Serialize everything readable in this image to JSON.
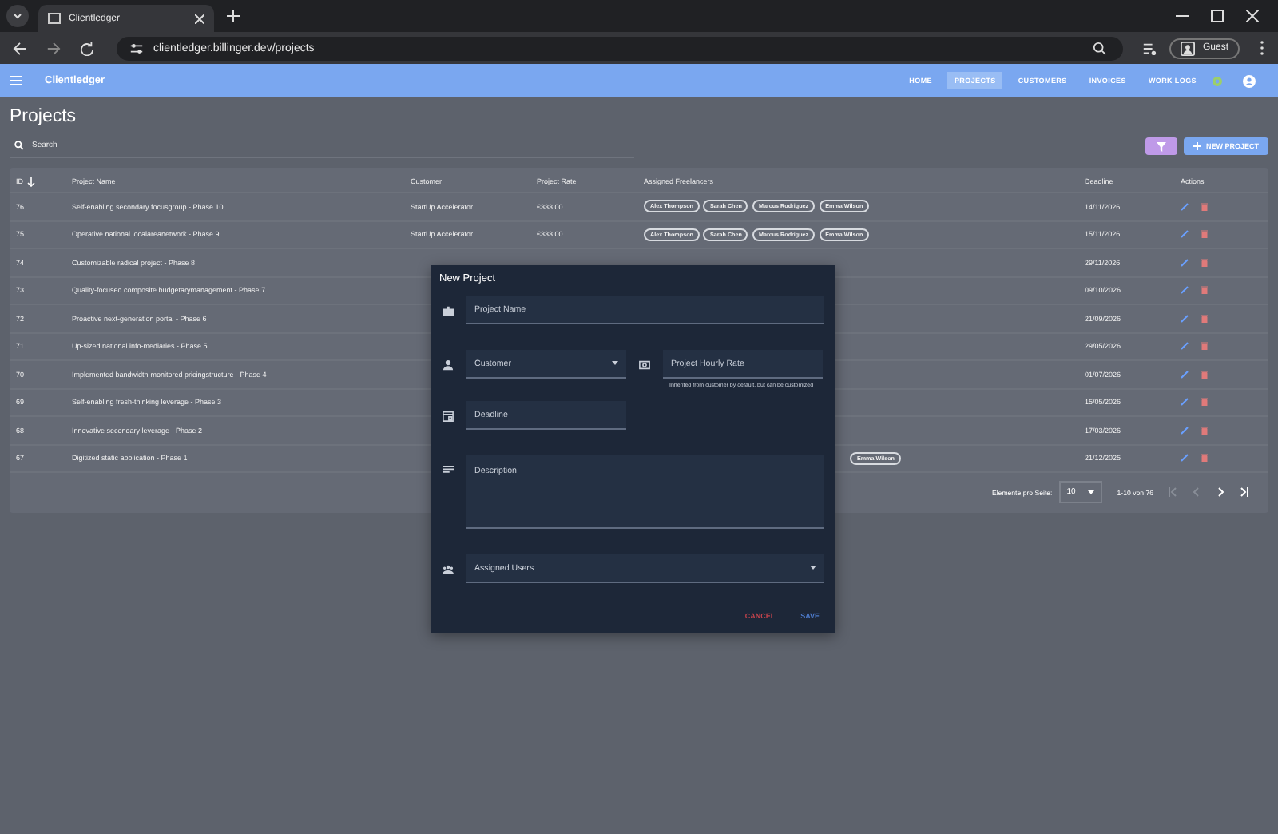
{
  "browser": {
    "tab_title": "Clientledger",
    "url": "clientledger.billinger.dev/projects",
    "profile": "Guest"
  },
  "app": {
    "brand": "Clientledger",
    "nav": [
      {
        "label": "HOME",
        "selected": false
      },
      {
        "label": "PROJECTS",
        "selected": true
      },
      {
        "label": "CUSTOMERS",
        "selected": false
      },
      {
        "label": "INVOICES",
        "selected": false
      },
      {
        "label": "WORK LOGS",
        "selected": false
      }
    ]
  },
  "page_title": "Projects",
  "search": {
    "placeholder": "Search"
  },
  "new_button": "NEW PROJECT",
  "table": {
    "columns": [
      "ID",
      "Project Name",
      "Customer",
      "Project Rate",
      "Assigned Freelancers",
      "Deadline",
      "Actions"
    ],
    "rows": [
      {
        "id": "76",
        "name": "Self-enabling secondary focusgroup - Phase 10",
        "customer": "StartUp Accelerator",
        "rate": "€333.00",
        "freelancers": [
          "Alex Thompson",
          "Sarah Chen",
          "Marcus Rodriguez",
          "Emma Wilson"
        ],
        "deadline": "14/11/2026"
      },
      {
        "id": "75",
        "name": "Operative national localareanetwork - Phase 9",
        "customer": "StartUp Accelerator",
        "rate": "€333.00",
        "freelancers": [
          "Alex Thompson",
          "Sarah Chen",
          "Marcus Rodriguez",
          "Emma Wilson"
        ],
        "deadline": "15/11/2026"
      },
      {
        "id": "74",
        "name": "Customizable radical project - Phase 8",
        "deadline": "29/11/2026"
      },
      {
        "id": "73",
        "name": "Quality-focused composite budgetarymanagement - Phase 7",
        "deadline": "09/10/2026"
      },
      {
        "id": "72",
        "name": "Proactive next-generation portal - Phase 6",
        "deadline": "21/09/2026"
      },
      {
        "id": "71",
        "name": "Up-sized national info-mediaries - Phase 5",
        "deadline": "29/05/2026"
      },
      {
        "id": "70",
        "name": "Implemented bandwidth-monitored pricingstructure - Phase 4",
        "deadline": "01/07/2026"
      },
      {
        "id": "69",
        "name": "Self-enabling fresh-thinking leverage - Phase 3",
        "deadline": "15/05/2026"
      },
      {
        "id": "68",
        "name": "Innovative secondary leverage - Phase 2",
        "deadline": "17/03/2026"
      },
      {
        "id": "67",
        "name": "Digitized static application - Phase 1",
        "freelancers": [
          "Emma Wilson"
        ],
        "deadline": "21/12/2025"
      }
    ]
  },
  "pagination": {
    "label": "Elemente pro Seite:",
    "per_page": "10",
    "range": "1-10 von 76"
  },
  "dialog": {
    "title": "New Project",
    "rows": [
      {
        "fields": [
          {
            "kind": "text",
            "label": "Project Name"
          }
        ]
      },
      {
        "fields": [
          {
            "kind": "select",
            "label": "Customer"
          },
          {
            "kind": "text",
            "label": "Project Hourly Rate",
            "hint": "Inherited from customer by default, but can be customized"
          }
        ]
      },
      {
        "fields": [
          {
            "kind": "text",
            "label": "Deadline"
          }
        ]
      },
      {
        "fields": [
          {
            "kind": "textarea",
            "label": "Description"
          }
        ]
      },
      {
        "fields": [
          {
            "kind": "select",
            "label": "Assigned Users"
          }
        ]
      }
    ],
    "actions": [
      {
        "kind": "cancel",
        "label": "CANCEL"
      },
      {
        "kind": "save",
        "label": "SAVE"
      }
    ]
  }
}
